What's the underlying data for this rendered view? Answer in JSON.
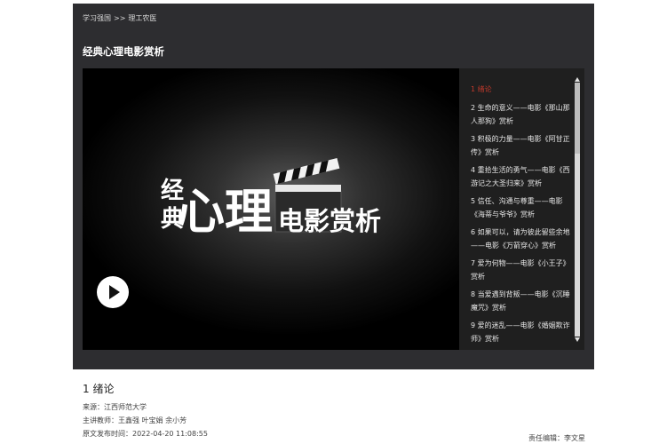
{
  "breadcrumb": {
    "items": [
      "学习强国",
      "理工农医"
    ],
    "separator": ">>"
  },
  "page_title": "经典心理电影赏析",
  "video": {
    "logo_text": {
      "vertical": [
        "经",
        "典"
      ],
      "main": "心理",
      "sub": "电影赏析"
    },
    "play_icon": "play-icon"
  },
  "playlist": {
    "items": [
      "1 绪论",
      "2 生命的意义——电影《那山那人那狗》赏析",
      "3 积极的力量——电影《阿甘正传》赏析",
      "4 重拾生活的勇气——电影《西游记之大圣归来》赏析",
      "5 信任、沟通与尊重——电影《海蒂与爷爷》赏析",
      "6 如果可以，请为彼此留些余地——电影《万箭穿心》赏析",
      "7 爱为何物——电影《小王子》赏析",
      "8 当爱遇到背叛——电影《沉睡魔咒》赏析",
      "9 爱的迷乱——电影《婚姻欺诈师》赏析"
    ],
    "active_index": 0
  },
  "info": {
    "title": "1 绪论",
    "source_label": "来源：",
    "source": "江西师范大学",
    "teacher_label": "主讲教师：",
    "teachers": "王鑫强 叶宝娟 余小芳",
    "published_label": "原文发布时间：",
    "published": "2022-04-20 11:08:55"
  },
  "editor": {
    "label": "责任编辑：",
    "name": "李文星"
  },
  "colors": {
    "panel": "#2d2d30",
    "active": "#c0392b",
    "playlist_bg": "#1f1f1f"
  }
}
